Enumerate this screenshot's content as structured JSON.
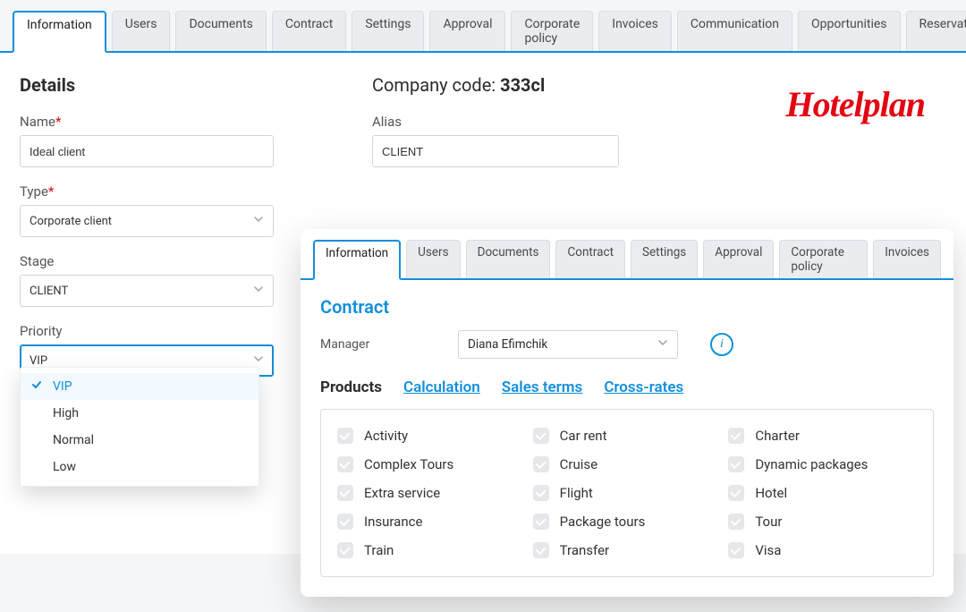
{
  "mainTabs": [
    {
      "label": "Information",
      "active": true
    },
    {
      "label": "Users"
    },
    {
      "label": "Documents"
    },
    {
      "label": "Contract"
    },
    {
      "label": "Settings"
    },
    {
      "label": "Approval"
    },
    {
      "label": "Corporate policy"
    },
    {
      "label": "Invoices"
    },
    {
      "label": "Communication"
    },
    {
      "label": "Opportunities"
    },
    {
      "label": "Reservations"
    }
  ],
  "details": {
    "title": "Details",
    "companyCodeLabel": "Company code: ",
    "companyCodeValue": "333cl",
    "logoText": "Hotelplan",
    "name": {
      "label": "Name",
      "required": true,
      "value": "Ideal client"
    },
    "alias": {
      "label": "Alias",
      "value": "CLIENT"
    },
    "type": {
      "label": "Type",
      "required": true,
      "value": "Corporate client"
    },
    "stage": {
      "label": "Stage",
      "value": "CLIENT"
    },
    "priority": {
      "label": "Priority",
      "value": "VIP",
      "options": [
        {
          "label": "VIP",
          "selected": true
        },
        {
          "label": "High"
        },
        {
          "label": "Normal"
        },
        {
          "label": "Low"
        }
      ]
    }
  },
  "innerTabs": [
    {
      "label": "Information",
      "active": true
    },
    {
      "label": "Users"
    },
    {
      "label": "Documents"
    },
    {
      "label": "Contract"
    },
    {
      "label": "Settings"
    },
    {
      "label": "Approval"
    },
    {
      "label": "Corporate policy"
    },
    {
      "label": "Invoices"
    }
  ],
  "contract": {
    "title": "Contract",
    "managerLabel": "Manager",
    "managerValue": "Diana Efimchik",
    "subTabs": {
      "products": "Products",
      "calculation": "Calculation",
      "salesTerms": "Sales terms",
      "crossRates": "Cross-rates"
    },
    "products": [
      "Activity",
      "Car rent",
      "Charter",
      "Complex Tours",
      "Cruise",
      "Dynamic packages",
      "Extra service",
      "Flight",
      "Hotel",
      "Insurance",
      "Package tours",
      "Tour",
      "Train",
      "Transfer",
      "Visa"
    ]
  }
}
